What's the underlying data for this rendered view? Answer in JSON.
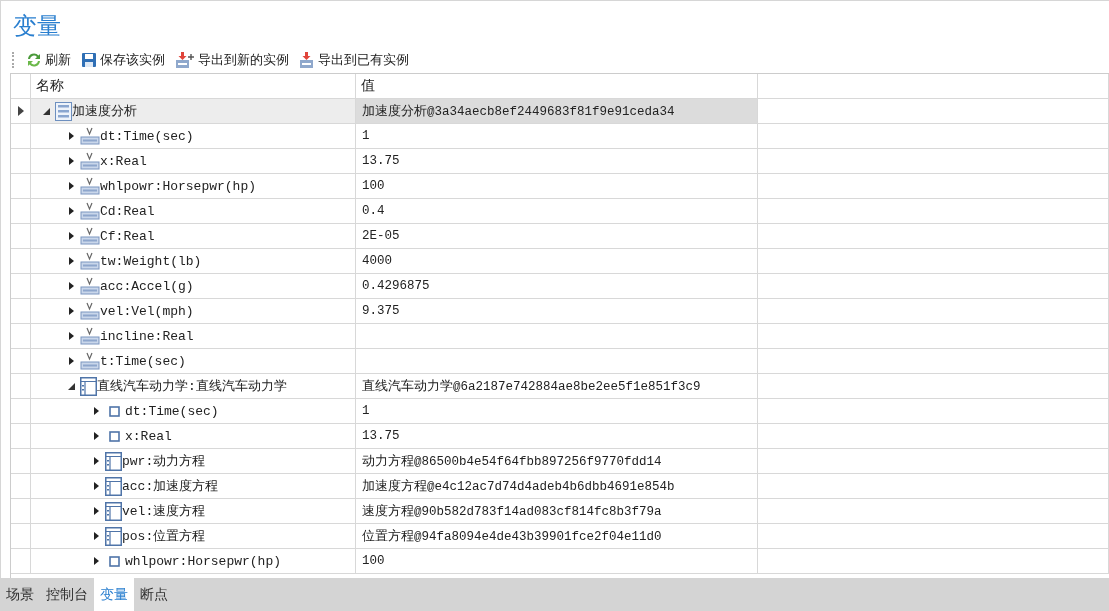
{
  "panel": {
    "title": "变量"
  },
  "toolbar": [
    {
      "kind": "refresh",
      "label": "刷新"
    },
    {
      "kind": "save",
      "label": "保存该实例"
    },
    {
      "kind": "export-new",
      "label": "导出到新的实例"
    },
    {
      "kind": "export-existing",
      "label": "导出到已有实例"
    }
  ],
  "table": {
    "columns": [
      "名称",
      "值"
    ],
    "rows": [
      {
        "name": "加速度分析",
        "value": "加速度分析@3a34aecb8ef2449683f81f9e91ceda34",
        "kind": "record",
        "expanded": true,
        "selected": true,
        "children": [
          {
            "name": "dt:Time(sec)",
            "value": "1",
            "kind": "variable",
            "expanded": false,
            "selected": false
          },
          {
            "name": "x:Real",
            "value": "13.75",
            "kind": "variable",
            "expanded": false,
            "selected": false
          },
          {
            "name": "whlpowr:Horsepwr(hp)",
            "value": "100",
            "kind": "variable",
            "expanded": false,
            "selected": false
          },
          {
            "name": "Cd:Real",
            "value": "0.4",
            "kind": "variable",
            "expanded": false,
            "selected": false
          },
          {
            "name": "Cf:Real",
            "value": "2E-05",
            "kind": "variable",
            "expanded": false,
            "selected": false
          },
          {
            "name": "tw:Weight(lb)",
            "value": "4000",
            "kind": "variable",
            "expanded": false,
            "selected": false
          },
          {
            "name": "acc:Accel(g)",
            "value": "0.4296875",
            "kind": "variable",
            "expanded": false,
            "selected": false
          },
          {
            "name": "vel:Vel(mph)",
            "value": "9.375",
            "kind": "variable",
            "expanded": false,
            "selected": false
          },
          {
            "name": "incline:Real",
            "kind": "variable",
            "expanded": false,
            "selected": false
          },
          {
            "name": "t:Time(sec)",
            "kind": "variable",
            "expanded": false,
            "selected": false
          },
          {
            "name": "直线汽车动力学:直线汽车动力学",
            "value": "直线汽车动力学@6a2187e742884ae8be2ee5f1e851f3c9",
            "kind": "object",
            "expanded": true,
            "selected": false,
            "children": [
              {
                "name": "dt:Time(sec)",
                "value": "1",
                "kind": "field",
                "expanded": false,
                "selected": false
              },
              {
                "name": "x:Real",
                "value": "13.75",
                "kind": "field",
                "expanded": false,
                "selected": false
              },
              {
                "name": "pwr:动力方程",
                "value": "动力方程@86500b4e54f64fbb897256f9770fdd14",
                "kind": "object",
                "expanded": false,
                "selected": false
              },
              {
                "name": "acc:加速度方程",
                "value": "加速度方程@e4c12ac7d74d4adeb4b6dbb4691e854b",
                "kind": "object",
                "expanded": false,
                "selected": false
              },
              {
                "name": "vel:速度方程",
                "value": "速度方程@90b582d783f14ad083cf814fc8b3f79a",
                "kind": "object",
                "expanded": false,
                "selected": false
              },
              {
                "name": "pos:位置方程",
                "value": "位置方程@94fa8094e4de43b39901fce2f04e11d0",
                "kind": "object",
                "expanded": false,
                "selected": false
              },
              {
                "name": "whlpowr:Horsepwr(hp)",
                "value": "100",
                "kind": "field",
                "expanded": false,
                "selected": false
              }
            ]
          }
        ]
      }
    ]
  },
  "bottom_tabs": [
    {
      "label": "场景",
      "selected": false
    },
    {
      "label": "控制台",
      "selected": false
    },
    {
      "label": "变量",
      "selected": true
    },
    {
      "label": "断点",
      "selected": false
    }
  ]
}
